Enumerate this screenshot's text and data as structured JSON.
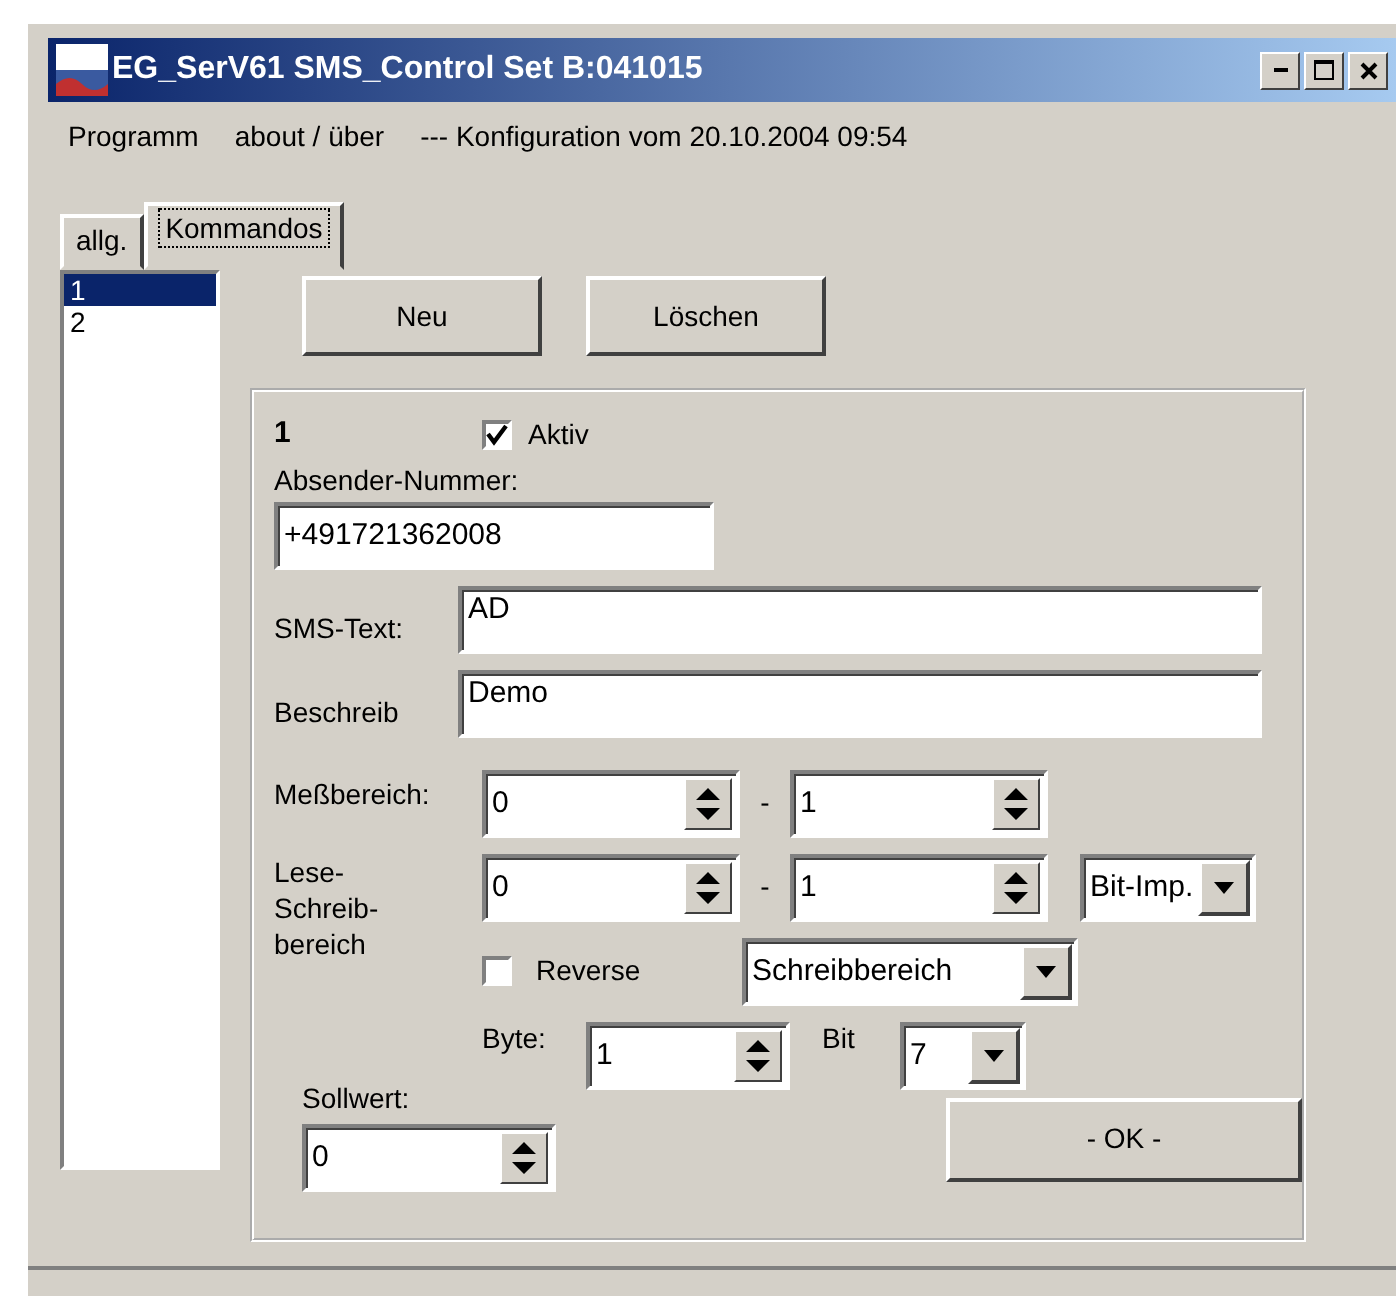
{
  "window": {
    "title": "EG_SerV61 SMS_Control Set B:041015"
  },
  "menu": [
    {
      "label": "Programm"
    },
    {
      "label": "about / über"
    }
  ],
  "menu_info": "--- Konfiguration vom 20.10.2004 09:54",
  "tabs": [
    {
      "label": "allg.",
      "selected": false
    },
    {
      "label": "Kommandos",
      "selected": true
    }
  ],
  "command_list": [
    {
      "label": "1",
      "selected": true
    },
    {
      "label": "2",
      "selected": false
    }
  ],
  "buttons": [
    "Neu",
    "Löschen"
  ],
  "command": {
    "number": "1",
    "active": {
      "label": "Aktiv",
      "checked": true
    },
    "sender_label": "Absender-Nummer:",
    "sender": "+491721362008",
    "sms_text_label": "SMS-Text:",
    "sms_text": "AD",
    "description_label": "Beschreib",
    "description": "Demo",
    "range_label": "Meßbereich:",
    "range_from": "0",
    "range_separator": "-",
    "range_to": "1",
    "rw_label": "Lese-Schreib-bereich",
    "rw_from": "0",
    "rw_separator": "-",
    "rw_to": "1",
    "rw_type": "Bit-Imp.",
    "reverse": {
      "label": "Reverse",
      "checked": false
    },
    "area": "Schreibbereich",
    "byte_label": "Byte:",
    "byte": "1",
    "bit_label": "Bit",
    "bit": "7",
    "setpoint_label": "Sollwert:",
    "setpoint": "0",
    "ok": "- OK -"
  }
}
